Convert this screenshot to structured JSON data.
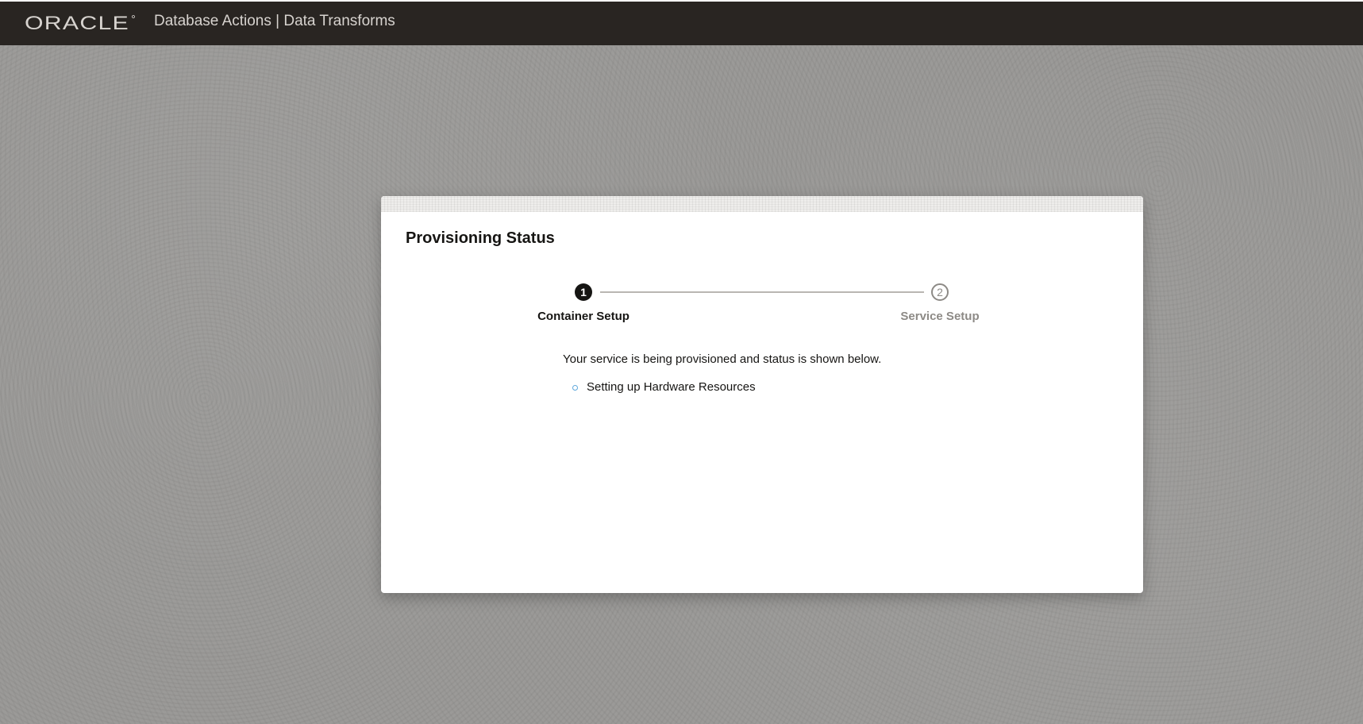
{
  "header": {
    "logo_text": "ORACLE",
    "app_title": "Database Actions | Data Transforms",
    "colors": {
      "bar": "#292522",
      "title": "#d7d3cf"
    }
  },
  "dialog": {
    "title": "Provisioning Status",
    "steps": [
      {
        "number": "1",
        "label": "Container Setup",
        "state": "active"
      },
      {
        "number": "2",
        "label": "Service Setup",
        "state": "pending"
      }
    ],
    "message": "Your service is being provisioned and status is shown below.",
    "status_items": [
      {
        "text": "Setting up Hardware Resources",
        "icon": "status-bullet-icon"
      }
    ]
  }
}
